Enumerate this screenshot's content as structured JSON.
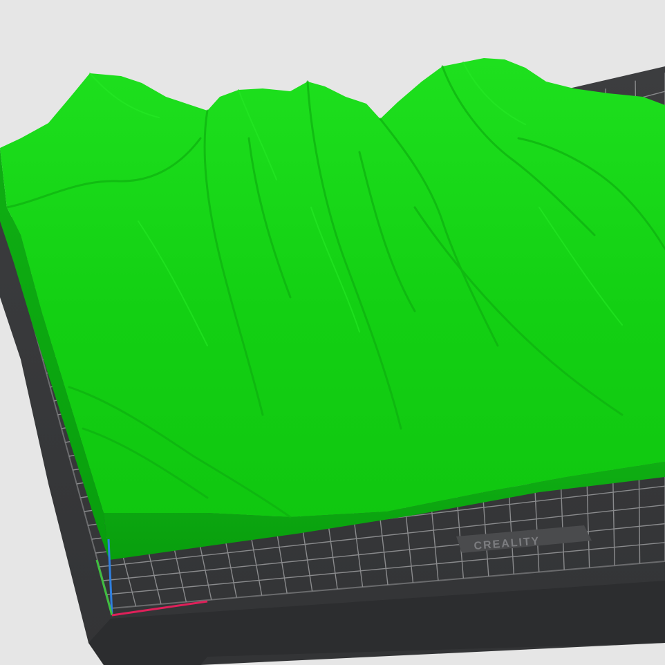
{
  "scene": {
    "background_color": "#e6e6e6",
    "model_color": "#14d614",
    "model_shadow_color": "#0aa70f",
    "bed_color": "#3a3b3d",
    "bed_grid_color": "#8a8b8d"
  },
  "build_plate": {
    "brand_label": "CREALITY"
  },
  "axes": {
    "x_color": "#e0205a",
    "y_color": "#3fbf3f",
    "z_color": "#2f7fdf"
  }
}
